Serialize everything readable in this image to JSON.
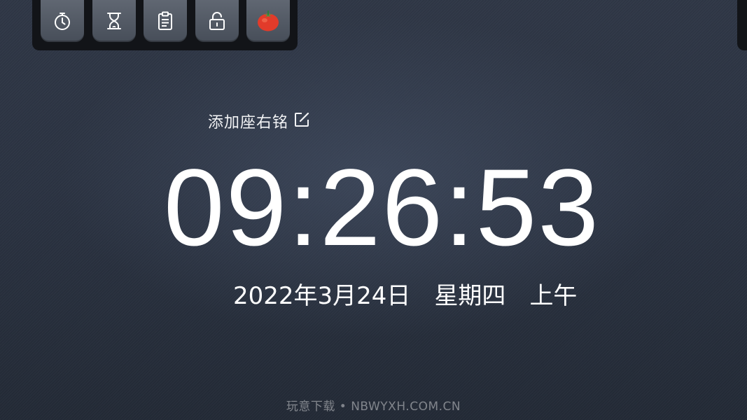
{
  "toolbar": {
    "buttons": [
      {
        "name": "stopwatch-button",
        "icon": "stopwatch-icon"
      },
      {
        "name": "hourglass-button",
        "icon": "hourglass-icon"
      },
      {
        "name": "clipboard-button",
        "icon": "clipboard-icon"
      },
      {
        "name": "lock-button",
        "icon": "lock-icon"
      },
      {
        "name": "tomato-button",
        "icon": "tomato-icon"
      }
    ]
  },
  "motto": {
    "text": "添加座右铭",
    "icon": "edit-icon"
  },
  "clock": {
    "time": "09:26:53"
  },
  "date": {
    "date": "2022年3月24日",
    "weekday": "星期四",
    "period": "上午"
  },
  "footer": {
    "watermark": "玩意下载 • NBWYXH.COM.CN"
  },
  "colors": {
    "background": "#2b3342",
    "toolbar": "#121418",
    "button": "#565d68",
    "text": "#ffffff",
    "tomato": "#e23b2a"
  }
}
